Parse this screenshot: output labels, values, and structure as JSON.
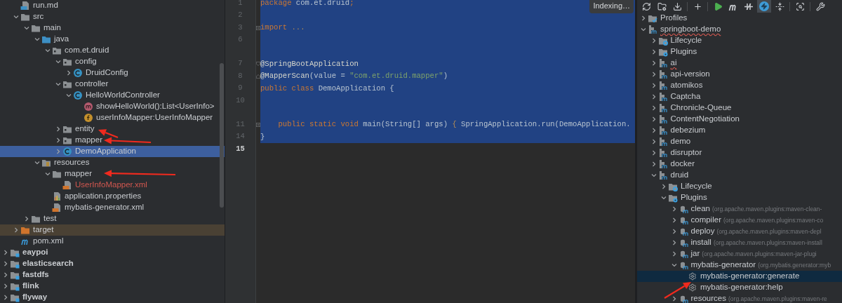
{
  "project_tree": {
    "continued_children": [
      {
        "label": "run.md",
        "kind": "markdown",
        "selected": false
      },
      {
        "label": "src",
        "kind": "folder",
        "expanded": true,
        "selected": false,
        "children": [
          {
            "label": "main",
            "kind": "folder",
            "expanded": true,
            "selected": false,
            "children": [
              {
                "label": "java",
                "kind": "source-folder",
                "expanded": true,
                "selected": false,
                "children": [
                  {
                    "label": "com.et.druid",
                    "kind": "package",
                    "expanded": true,
                    "selected": false,
                    "children": [
                      {
                        "label": "config",
                        "kind": "package",
                        "expanded": true,
                        "selected": false,
                        "children": [
                          {
                            "label": "DruidConfig",
                            "kind": "class",
                            "expanded": false,
                            "selected": false
                          }
                        ]
                      },
                      {
                        "label": "controller",
                        "kind": "package",
                        "expanded": true,
                        "selected": false,
                        "children": [
                          {
                            "label": "HelloWorldController",
                            "kind": "class",
                            "expanded": true,
                            "selected": false,
                            "children": [
                              {
                                "label": "showHelloWorld():List<UserInfo>",
                                "kind": "method",
                                "selected": false
                              },
                              {
                                "label": "userInfoMapper:UserInfoMapper",
                                "kind": "field",
                                "selected": false
                              }
                            ]
                          }
                        ]
                      },
                      {
                        "label": "entity",
                        "kind": "package",
                        "expanded": false,
                        "selected": false
                      },
                      {
                        "label": "mapper",
                        "kind": "package",
                        "expanded": false,
                        "selected": false
                      },
                      {
                        "label": "DemoApplication",
                        "kind": "class",
                        "expanded": false,
                        "selected": true
                      }
                    ]
                  }
                ]
              },
              {
                "label": "resources",
                "kind": "resources-folder",
                "expanded": true,
                "selected": false,
                "children": [
                  {
                    "label": "mapper",
                    "kind": "folder",
                    "expanded": true,
                    "selected": false,
                    "children": [
                      {
                        "label": "UserInfoMapper.xml",
                        "kind": "xml",
                        "unversioned": true,
                        "selected": false
                      }
                    ]
                  },
                  {
                    "label": "application.properties",
                    "kind": "properties",
                    "selected": false
                  },
                  {
                    "label": "mybatis-generator.xml",
                    "kind": "xml",
                    "selected": false
                  }
                ]
              }
            ]
          },
          {
            "label": "test",
            "kind": "folder",
            "expanded": false,
            "selected": false
          }
        ]
      },
      {
        "label": "target",
        "kind": "excluded-folder",
        "expanded": false,
        "selected": false
      },
      {
        "label": "pom.xml",
        "kind": "maven-file",
        "selected": false
      }
    ],
    "items": [
      {
        "label": "eaypoi",
        "kind": "module",
        "expanded": false,
        "selected": false
      },
      {
        "label": "elasticsearch",
        "kind": "module",
        "expanded": false,
        "selected": false
      },
      {
        "label": "fastdfs",
        "kind": "module",
        "expanded": false,
        "selected": false
      },
      {
        "label": "flink",
        "kind": "module",
        "expanded": false,
        "selected": false
      },
      {
        "label": "flyway",
        "kind": "module",
        "expanded": false,
        "selected": false
      }
    ]
  },
  "editor": {
    "badge": "Indexing…",
    "lines": [
      {
        "number": "1",
        "selected": true,
        "tokens": [
          {
            "kind": "keyword",
            "text": "package"
          },
          {
            "kind": "plain",
            "text": " com.et.druid"
          },
          {
            "kind": "keyword",
            "text": ";"
          }
        ]
      },
      {
        "number": "2",
        "selected": true
      },
      {
        "number": "3",
        "selected": true,
        "collapsed": true,
        "tokens": [
          {
            "kind": "keyword",
            "text": "import"
          },
          {
            "kind": "folded",
            "text": " ..."
          }
        ]
      },
      {
        "number": "6",
        "selected": true
      },
      {
        "kind": "gap",
        "selected": true
      },
      {
        "number": "7",
        "selected": true,
        "fold_start": true,
        "tokens": [
          {
            "kind": "annotation",
            "text": "@SpringBootApplication"
          }
        ]
      },
      {
        "number": "8",
        "selected": true,
        "fold_end": true,
        "tokens": [
          {
            "kind": "annotation",
            "text": "@MapperScan"
          },
          {
            "kind": "plain",
            "text": "(value = "
          },
          {
            "kind": "string",
            "text": "\"com.et.druid.mapper\""
          },
          {
            "kind": "plain",
            "text": ")"
          }
        ]
      },
      {
        "number": "9",
        "selected": true,
        "tokens": [
          {
            "kind": "keyword",
            "text": "public class"
          },
          {
            "kind": "plain",
            "text": " DemoApplication {"
          }
        ]
      },
      {
        "number": "10",
        "selected": true
      },
      {
        "kind": "gap",
        "selected": true
      },
      {
        "number": "11",
        "selected": true,
        "collapsed": true,
        "tokens": [
          {
            "kind": "keyword",
            "text": "    public static void"
          },
          {
            "kind": "plain",
            "text": " main(String[] args) "
          },
          {
            "kind": "folded",
            "text": "{"
          },
          {
            "kind": "plain",
            "text": " SpringApplication.run(DemoApplication."
          }
        ]
      },
      {
        "number": "14",
        "selected": true,
        "tokens": [
          {
            "kind": "plain",
            "text": "}"
          }
        ]
      },
      {
        "number": "15",
        "selected": false,
        "current": true
      }
    ]
  },
  "maven": {
    "toolbar": [
      [
        {
          "selected": false
        },
        {
          "selected": false
        },
        {
          "selected": false
        }
      ],
      [
        {
          "selected": false
        }
      ],
      [
        {
          "selected": false
        },
        {
          "selected": false
        },
        {
          "selected": false
        },
        {
          "selected": true
        },
        {
          "selected": false
        }
      ],
      [
        {
          "selected": false
        }
      ],
      [
        {
          "selected": false
        }
      ]
    ],
    "tree": [
      {
        "label": "Profiles",
        "kind": "profiles",
        "expanded": false,
        "selected": false
      },
      {
        "label": "springboot-demo",
        "kind": "project",
        "expanded": true,
        "misspelled": true,
        "selected": false,
        "children": [
          {
            "label": "Lifecycle",
            "kind": "lifecycle",
            "expanded": false,
            "selected": false
          },
          {
            "label": "Plugins",
            "kind": "plugins",
            "expanded": false,
            "selected": false
          },
          {
            "label": "ai",
            "kind": "project",
            "expanded": false,
            "misspelled": true,
            "selected": false
          },
          {
            "label": "api-version",
            "kind": "project",
            "expanded": false,
            "selected": false
          },
          {
            "label": "atomikos",
            "kind": "project",
            "expanded": false,
            "selected": false
          },
          {
            "label": "Captcha",
            "kind": "project",
            "expanded": false,
            "selected": false
          },
          {
            "label": "Chronicle-Queue",
            "kind": "project",
            "expanded": false,
            "selected": false
          },
          {
            "label": "ContentNegotiation",
            "kind": "project",
            "expanded": false,
            "selected": false
          },
          {
            "label": "debezium",
            "kind": "project",
            "expanded": false,
            "selected": false
          },
          {
            "label": "demo",
            "kind": "project",
            "expanded": false,
            "selected": false
          },
          {
            "label": "disruptor",
            "kind": "project",
            "expanded": false,
            "selected": false
          },
          {
            "label": "docker",
            "kind": "project",
            "expanded": false,
            "selected": false
          },
          {
            "label": "druid",
            "kind": "project",
            "expanded": true,
            "selected": false,
            "children": [
              {
                "label": "Lifecycle",
                "kind": "lifecycle",
                "expanded": false,
                "selected": false
              },
              {
                "label": "Plugins",
                "kind": "plugins",
                "expanded": true,
                "selected": false,
                "children": [
                  {
                    "label": "clean",
                    "detail": "(org.apache.maven.plugins:maven-clean-",
                    "kind": "plugin",
                    "expanded": false,
                    "selected": false
                  },
                  {
                    "label": "compiler",
                    "detail": "(org.apache.maven.plugins:maven-co",
                    "kind": "plugin",
                    "expanded": false,
                    "selected": false
                  },
                  {
                    "label": "deploy",
                    "detail": "(org.apache.maven.plugins:maven-depl",
                    "kind": "plugin",
                    "expanded": false,
                    "selected": false
                  },
                  {
                    "label": "install",
                    "detail": "(org.apache.maven.plugins:maven-install",
                    "kind": "plugin",
                    "expanded": false,
                    "selected": false
                  },
                  {
                    "label": "jar",
                    "detail": "(org.apache.maven.plugins:maven-jar-plugi",
                    "kind": "plugin",
                    "expanded": false,
                    "selected": false
                  },
                  {
                    "label": "mybatis-generator",
                    "detail": "(org.mybatis.generator:myb",
                    "kind": "plugin",
                    "expanded": true,
                    "selected": false,
                    "children": [
                      {
                        "label": "mybatis-generator:generate",
                        "kind": "goal",
                        "selected": true
                      },
                      {
                        "label": "mybatis-generator:help",
                        "kind": "goal",
                        "selected": false
                      }
                    ]
                  },
                  {
                    "label": "resources",
                    "detail": "(org.apache.maven.plugins:maven-re",
                    "kind": "plugin",
                    "expanded": false,
                    "selected": false
                  }
                ]
              }
            ]
          }
        ]
      }
    ]
  }
}
